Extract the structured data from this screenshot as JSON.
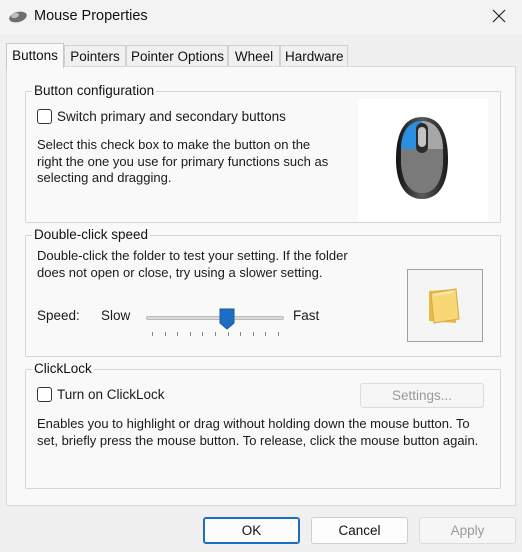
{
  "window": {
    "title": "Mouse Properties",
    "icon": "mouse-icon"
  },
  "tabs": [
    {
      "label": "Buttons",
      "active": true
    },
    {
      "label": "Pointers",
      "active": false
    },
    {
      "label": "Pointer Options",
      "active": false
    },
    {
      "label": "Wheel",
      "active": false
    },
    {
      "label": "Hardware",
      "active": false
    }
  ],
  "button_config": {
    "legend": "Button configuration",
    "checkbox_label": "Switch primary and secondary buttons",
    "checked": false,
    "description": "Select this check box to make the button on the right the one you use for primary functions such as selecting and dragging."
  },
  "double_click": {
    "legend": "Double-click speed",
    "description": "Double-click the folder to test your setting. If the folder does not open or close, try using a slower setting.",
    "speed_label": "Speed:",
    "slow_label": "Slow",
    "fast_label": "Fast",
    "speed_value": 0.59,
    "tick_count": 11
  },
  "clicklock": {
    "legend": "ClickLock",
    "checkbox_label": "Turn on ClickLock",
    "checked": false,
    "settings_label": "Settings...",
    "description": "Enables you to highlight or drag without holding down the mouse button. To set, briefly press the mouse button. To release, click the mouse button again."
  },
  "footer": {
    "ok_label": "OK",
    "cancel_label": "Cancel",
    "apply_label": "Apply"
  },
  "colors": {
    "accent": "#1b6ec2",
    "mouse_blue": "#2a8fe0",
    "folder_yellow": "#f5d36b"
  }
}
